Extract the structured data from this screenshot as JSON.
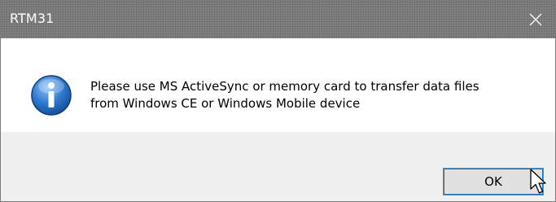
{
  "window": {
    "title": "RTM31",
    "close_icon": "close-icon"
  },
  "message": {
    "icon": "info-icon",
    "text": "Please use MS ActiveSync or memory card to transfer data files\nfrom Windows CE or Windows Mobile device"
  },
  "buttons": {
    "ok_label": "OK"
  },
  "colors": {
    "titlebar": "#7f7f7f",
    "footer": "#f0f0f0",
    "info_icon_blue": "#2a6fc4"
  }
}
